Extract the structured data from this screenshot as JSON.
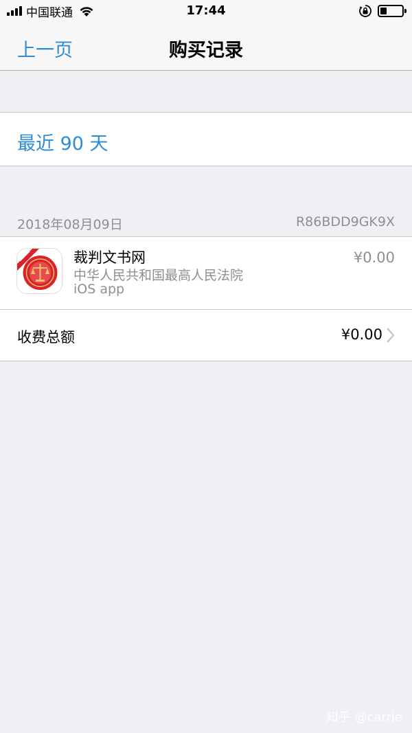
{
  "status_bar": {
    "carrier": "中国联通",
    "time": "17:44",
    "battery_level": 0.3
  },
  "nav": {
    "back_label": "上一页",
    "title": "购买记录"
  },
  "filter": {
    "label": "最近 90 天"
  },
  "section": {
    "date": "2018年08月09日",
    "order_id": "R86BDD9GK9X"
  },
  "purchase": {
    "app_name": "裁判文书网",
    "developer": "中华人民共和国最高人民法院",
    "kind": "iOS app",
    "price": "¥0.00",
    "icon": "court-emblem-icon"
  },
  "total": {
    "label": "收费总额",
    "amount": "¥0.00"
  },
  "watermark": "知乎 @carrie",
  "colors": {
    "accent": "#2e8bd6",
    "background": "#efeff4",
    "secondary_text": "#8e8e93",
    "emblem_red": "#d9232a"
  }
}
